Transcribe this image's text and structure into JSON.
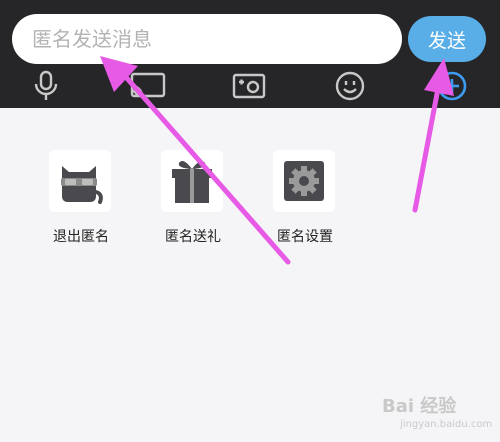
{
  "input": {
    "placeholder": "匿名发送消息",
    "value": ""
  },
  "send_label": "发送",
  "toolbar": {
    "icons": [
      "microphone-icon",
      "screen-share-icon",
      "photo-icon",
      "emoji-icon",
      "plus-circle-icon"
    ],
    "active_color": "#3d9cf0",
    "icon_color": "#c8c8c8"
  },
  "apps": [
    {
      "label": "退出匿名",
      "icon": "anonymous-cat-icon"
    },
    {
      "label": "匿名送礼",
      "icon": "gift-icon"
    },
    {
      "label": "匿名设置",
      "icon": "settings-gear-icon"
    }
  ],
  "watermark": {
    "brand": "Bai 经验",
    "url": "jingyan.baidu.com"
  },
  "colors": {
    "topbar": "#262628",
    "send_button": "#5aaee8",
    "panel_bg": "#f5f5f7",
    "annotation_arrow": "#e65ae6"
  }
}
